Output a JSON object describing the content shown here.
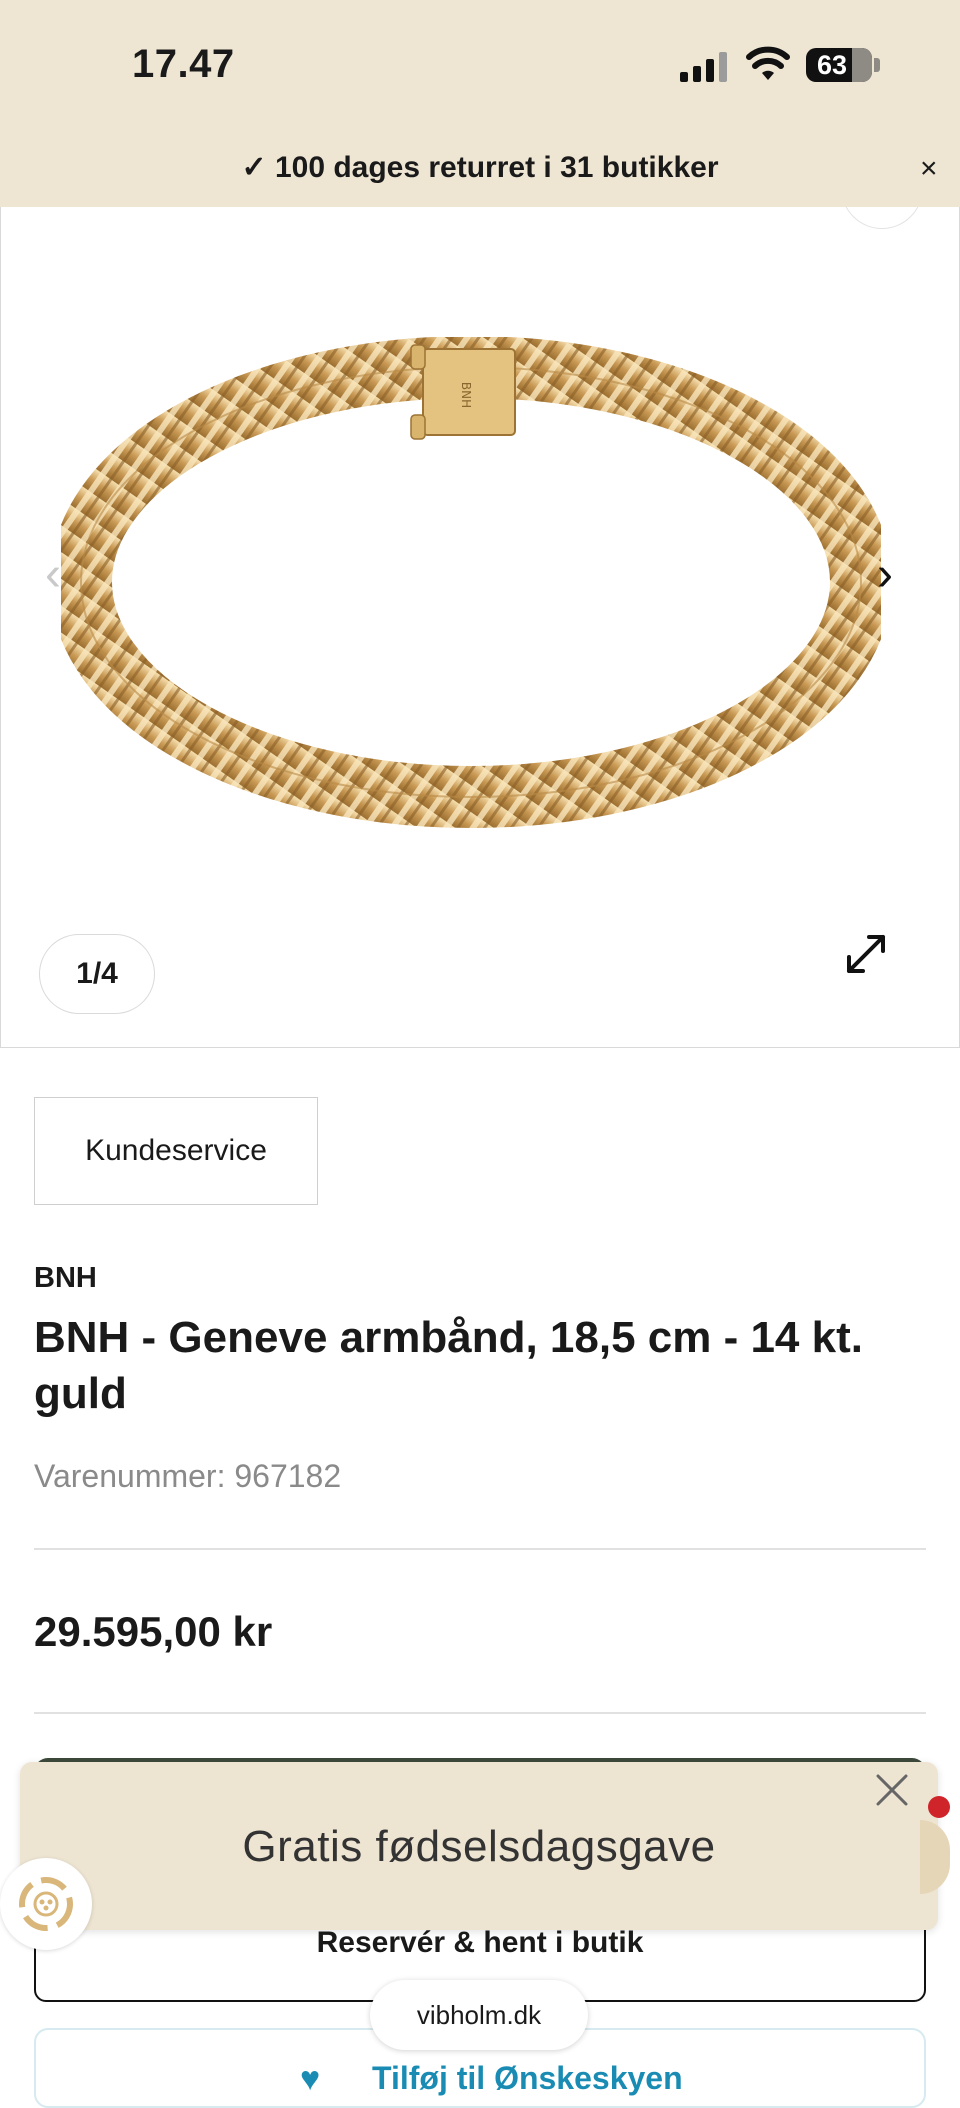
{
  "status_bar": {
    "time": "17.47",
    "battery": "63"
  },
  "promo_banner": {
    "text": "✓ 100 dages returret i 31 butikker",
    "close_glyph": "×"
  },
  "gallery": {
    "counter": "1/4",
    "prev_glyph": "‹",
    "next_glyph": "›"
  },
  "customer_service": {
    "label": "Kundeservice"
  },
  "product": {
    "brand": "BNH",
    "title": "BNH - Geneve armbånd, 18,5 cm - 14 kt. guld",
    "sku_label": "Varenummer: 967182",
    "price": "29.595,00 kr"
  },
  "actions": {
    "reserve_label": "Reservér & hent i butik",
    "wishlist_label": "Tilføj til Ønskeskyen"
  },
  "popup": {
    "text": "Gratis fødselsdagsgave"
  },
  "browser": {
    "url": "vibholm.dk"
  },
  "colors": {
    "banner_bg": "#eee5d3",
    "popup_bg": "#eee4d2",
    "primary_button": "#3d4a3b",
    "wishlist_accent": "#1a8cb4",
    "notification": "#d0242b"
  },
  "icons": {
    "signal": "cellular-signal-icon",
    "wifi": "wifi-icon",
    "battery": "battery-icon",
    "expand": "expand-icon",
    "close": "close-icon",
    "gift": "gift-icon",
    "heart": "cloud-heart-icon"
  }
}
